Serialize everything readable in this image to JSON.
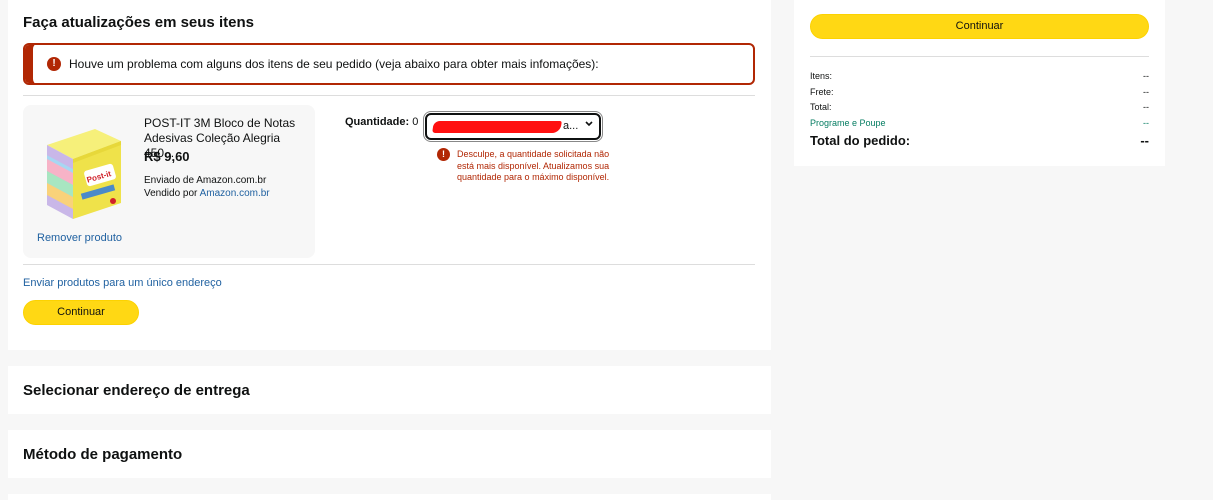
{
  "updates": {
    "title": "Faça atualizações em seus itens",
    "alert_text": "Houve um problema com alguns dos itens de seu pedido (veja abaixo para obter mais infomações):",
    "product": {
      "title": "POST-IT 3M Bloco de Notas Adesivas Coleção Alegria 450...",
      "price": "R$ 9,60",
      "shipped_by": "Enviado de Amazon.com.br",
      "sold_by_label": "Vendido por ",
      "sold_by_link": "Amazon.com.br",
      "remove_label": "Remover produto",
      "image_brand": "Post-it"
    },
    "quantity": {
      "label": "Quantidade:",
      "value": "0",
      "select_visible_text": "a...",
      "error": "Desculpe, a quantidade solicitada não está mais disponível. Atualizamos sua quantidade para o máximo disponível."
    },
    "ship_link": "Enviar produtos para um único endereço",
    "continue_label": "Continuar"
  },
  "address_section": {
    "title": "Selecionar endereço de entrega"
  },
  "payment_section": {
    "title": "Método de pagamento"
  },
  "summary": {
    "continue_label": "Continuar",
    "rows": [
      {
        "label": "Itens:",
        "value": "--"
      },
      {
        "label": "Frete:",
        "value": "--"
      },
      {
        "label": "Total:",
        "value": "--"
      },
      {
        "label": "Programe e Poupe",
        "value": "--"
      }
    ],
    "total_label": "Total do pedido:",
    "total_value": "--"
  },
  "colors": {
    "accent_yellow": "#ffd814",
    "error_red": "#b12704",
    "link_blue": "#2162a1",
    "green": "#067d62"
  }
}
